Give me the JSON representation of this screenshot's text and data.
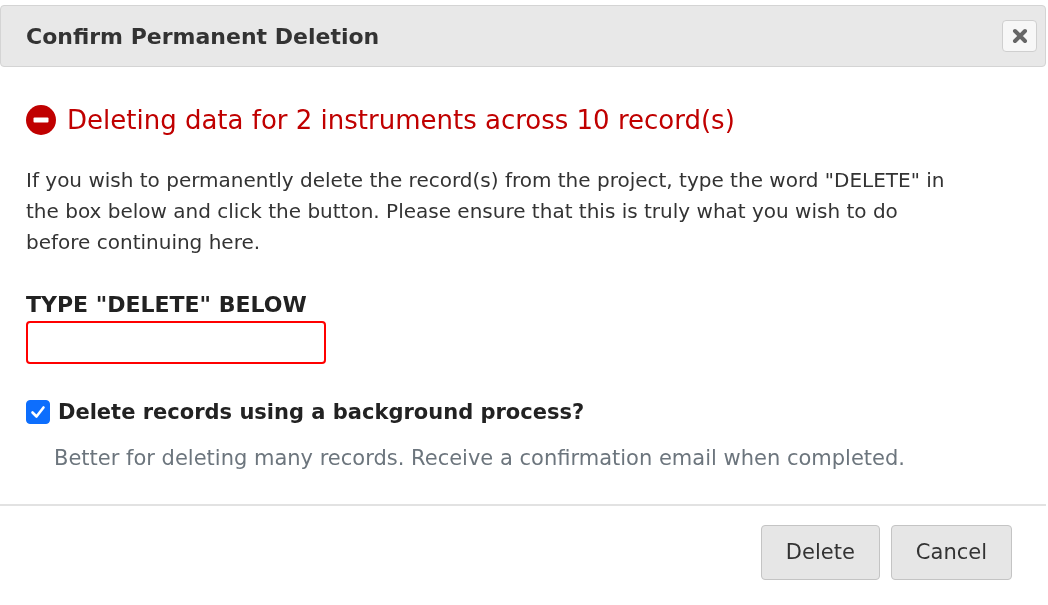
{
  "dialog": {
    "title": "Confirm Permanent Deletion",
    "warning": "Deleting data for 2 instruments across 10 record(s)",
    "instructions": "If you wish to permanently delete the record(s) from the project, type the word \"DELETE\" in the box below and click the button. Please ensure that this is truly what you wish to do before continuing here.",
    "confirm_field": {
      "label": "TYPE \"DELETE\" BELOW",
      "invalid": true
    },
    "background_option": {
      "label": "Delete records using a background process?",
      "checked": true,
      "hint": "Better for deleting many records. Receive a confirmation email when completed."
    },
    "buttons": [
      {
        "label": "Delete"
      },
      {
        "label": "Cancel"
      }
    ]
  }
}
